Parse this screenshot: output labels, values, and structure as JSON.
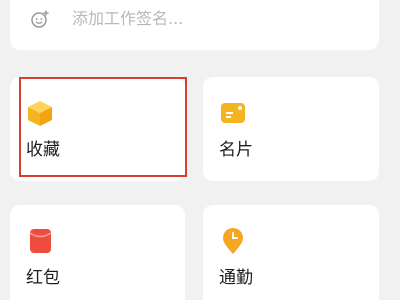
{
  "signature": {
    "placeholder": "添加工作签名...",
    "icon": "smile-plus-icon"
  },
  "cards": [
    {
      "label": "收藏",
      "icon": "favorite-box-icon",
      "color": "#f5b31f"
    },
    {
      "label": "名片",
      "icon": "business-card-icon",
      "color": "#f5b31f"
    },
    {
      "label": "红包",
      "icon": "red-envelope-icon",
      "color": "#ef4b3f"
    },
    {
      "label": "通勤",
      "icon": "commute-location-icon",
      "color": "#f5a623"
    }
  ],
  "highlight_color": "#d6412f"
}
